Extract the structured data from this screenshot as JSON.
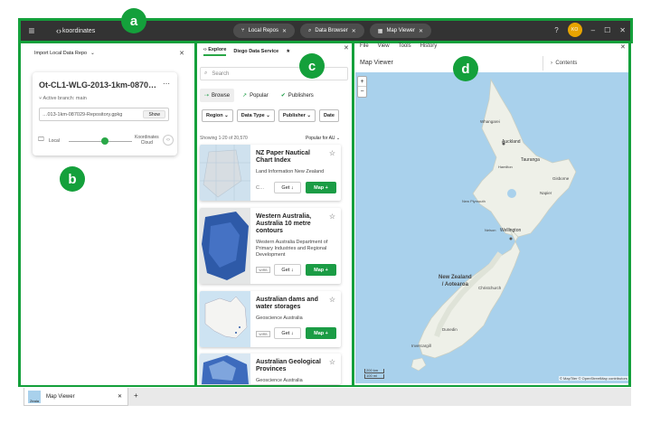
{
  "topbar": {
    "menu_icon": "hamburger-icon",
    "logo_text": "koordinates",
    "tabs": [
      {
        "label": "Local Repos",
        "icon": "branch-icon"
      },
      {
        "label": "Data Browser",
        "icon": "search-icon"
      },
      {
        "label": "Map Viewer",
        "icon": "map-icon"
      }
    ],
    "avatar_initials": "KO",
    "avatar_color": "#e7a400"
  },
  "callouts": {
    "a": "a",
    "b": "b",
    "c": "c",
    "d": "d"
  },
  "panel_b": {
    "import_label": "Import Local Data Repo",
    "repo_title": "Ot-CL1-WLG-2013-1km-0870…",
    "branch_label": "Active branch: main",
    "file_name": "…013-1km-087029-Repository.gpkg",
    "show_label": "Show",
    "local_label": "Local",
    "cloud_label_1": "Koordinates",
    "cloud_label_2": "Cloud"
  },
  "panel_c": {
    "tab_explore": "Explore",
    "tab_service": "Diego Data Service",
    "search_placeholder": "Search",
    "nav": [
      "Browse",
      "Popular",
      "Publishers"
    ],
    "filters": [
      "Region",
      "Data Type",
      "Publisher",
      "Date"
    ],
    "count_text": "Showing 1-20 of 20,570",
    "sort_text": "Popular for AU",
    "get_label": "Get",
    "map_label": "Map",
    "cards": [
      {
        "title": "NZ Paper Nautical Chart Index",
        "publisher": "Land Information New Zealand",
        "extra": "C…"
      },
      {
        "title": "Western Australia, Australia 10 metre contours",
        "publisher": "Western Australia Department of Primary Industries and Regional Development",
        "logo": "WIRB"
      },
      {
        "title": "Australian dams and water storages",
        "publisher": "Geoscience Australia",
        "logo": "WIRB"
      },
      {
        "title": "Australian Geological Provinces",
        "publisher": "Geoscience Australia"
      }
    ]
  },
  "panel_d": {
    "menu": [
      "File",
      "View",
      "Tools",
      "History"
    ],
    "title": "Map Viewer",
    "contents_label": "Contents",
    "map_labels": {
      "auckland": "Auckland",
      "tauranga": "Tauranga",
      "whangarei": "Whangarei",
      "gisborne": "Gisborne",
      "napier": "Napier",
      "new_plymouth": "New Plymouth",
      "hamilton": "Hamilton",
      "wellington": "Wellington",
      "nelson": "Nelson",
      "christchurch": "Christchurch",
      "dunedin": "Dunedin",
      "invercargill": "Invercargill",
      "country_1": "New Zealand",
      "country_2": "/ Aotearoa"
    },
    "scale_km": "200 km",
    "scale_mi": "100 mi",
    "attribution": "© MapTiler © OpenStreetMap contributors"
  },
  "bottom": {
    "tab_label": "Map Viewer",
    "tab_icon_text": "Zeala"
  }
}
